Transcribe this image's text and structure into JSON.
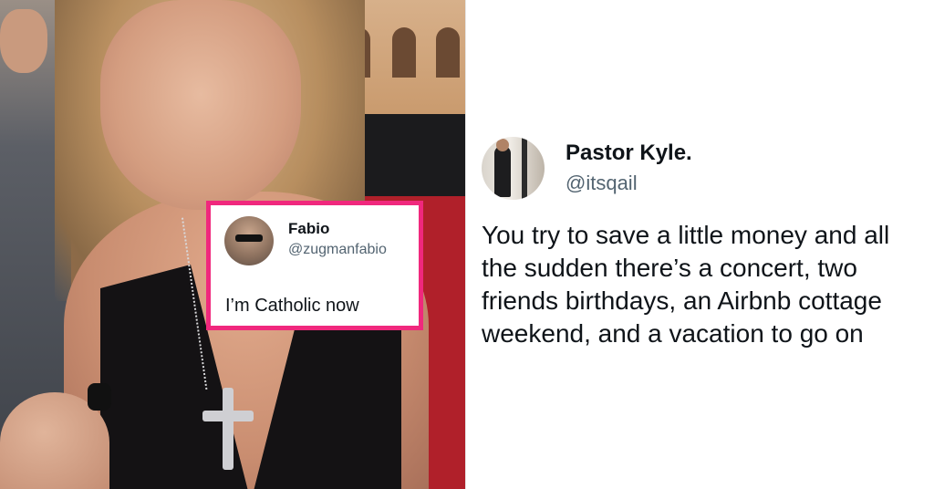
{
  "embedded_tweet": {
    "name": "Fabio",
    "handle": "@zugmanfabio",
    "text": "I’m Catholic now",
    "border_color": "#f0287d"
  },
  "main_tweet": {
    "name": "Pastor Kyle.",
    "handle": "@itsqail",
    "text": "You try to save a little money and all the sudden there’s a concert, two friends birthdays, an Airbnb cottage weekend, and a vacation to go on"
  }
}
